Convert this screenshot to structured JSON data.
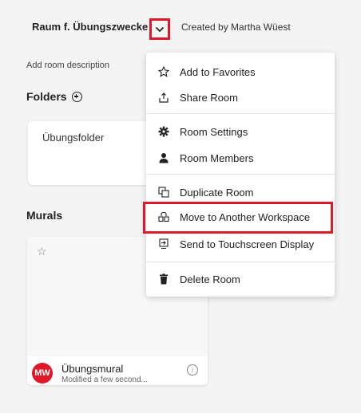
{
  "header": {
    "room_title": "Raum f. Übungszwecke",
    "created_by": "Created by Martha Wüest"
  },
  "content": {
    "add_description": "Add room description",
    "folders_heading": "Folders",
    "folder_name": "Übungsfolder",
    "murals_heading": "Murals",
    "mural": {
      "avatar_initials": "MW",
      "name": "Übungsmural",
      "modified": "Modified a few second..."
    }
  },
  "menu": {
    "items": [
      {
        "label": "Add to Favorites",
        "icon": "star-icon"
      },
      {
        "label": "Share Room",
        "icon": "share-icon"
      },
      {
        "label": "Room Settings",
        "icon": "gear-icon"
      },
      {
        "label": "Room Members",
        "icon": "person-icon"
      },
      {
        "label": "Duplicate Room",
        "icon": "duplicate-icon"
      },
      {
        "label": "Move to Another Workspace",
        "icon": "move-icon"
      },
      {
        "label": "Send to Touchscreen Display",
        "icon": "touchscreen-icon"
      },
      {
        "label": "Delete Room",
        "icon": "trash-icon"
      }
    ]
  },
  "colors": {
    "highlight": "#e0192a",
    "avatar": "#e0192a",
    "background": "#f4f4f4"
  }
}
